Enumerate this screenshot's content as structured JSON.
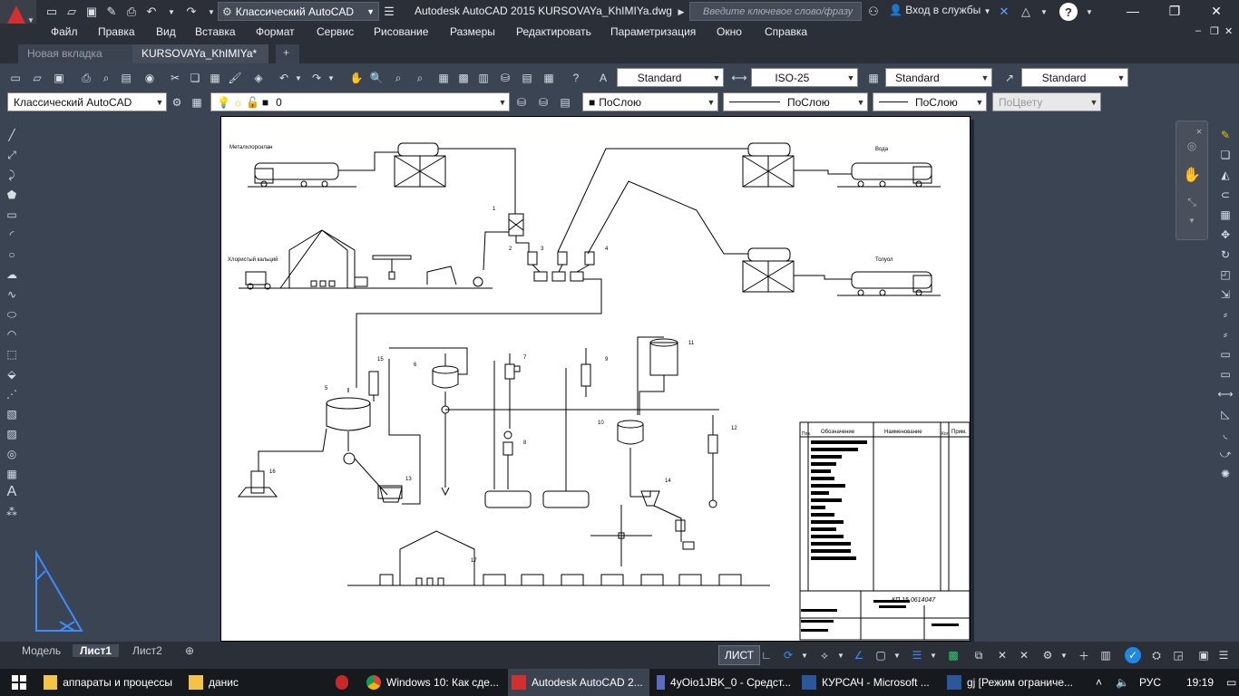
{
  "titlebar": {
    "workspace": "Классический AutoCAD",
    "app_title": "Autodesk AutoCAD 2015    KURSOVAYa_KhIMIYa.dwg",
    "search_placeholder": "Введите ключевое слово/фразу",
    "signin": "Вход в службы",
    "help": "?"
  },
  "menu": [
    "Файл",
    "Правка",
    "Вид",
    "Вставка",
    "Формат",
    "Сервис",
    "Рисование",
    "Размеры",
    "Редактировать",
    "Параметризация",
    "Окно",
    "Справка"
  ],
  "tabs": {
    "new_tab": "Новая вкладка",
    "active_tab": "KURSOVAYa_KhIMIYa*",
    "add": "+"
  },
  "toolbar1": {
    "text_style": "Standard",
    "dim_style": "ISO-25",
    "table_style": "Standard",
    "mleader_style": "Standard"
  },
  "toolbar2": {
    "workspace": "Классический AutoCAD",
    "layer": "0",
    "color": "ПоСлою",
    "linetype": "ПоСлою",
    "lineweight": "ПоСлою",
    "plotstyle": "ПоЦвету"
  },
  "layout_tabs": [
    "Модель",
    "Лист1",
    "Лист2"
  ],
  "status": {
    "sheet_label": "ЛИСТ"
  },
  "drawing": {
    "labels": {
      "metal": "Металхлорсилан",
      "water": "Вода",
      "calcium": "Хлористый кальций",
      "toluene": "Толуол",
      "title_code": "КП 15 0614047"
    },
    "numbers": [
      "1",
      "2",
      "3",
      "4",
      "5",
      "6",
      "7",
      "8",
      "9",
      "10",
      "11",
      "12",
      "13",
      "14",
      "15",
      "16",
      "17"
    ],
    "table_headers": [
      "Поз.",
      "Обозначение",
      "Наименование",
      "Кол.",
      "Прим."
    ]
  },
  "taskbar": {
    "items": [
      "аппараты и процессы",
      "данис",
      "Windows 10: Как сде...",
      "Autodesk AutoCAD 2...",
      "4yOio1JBK_0 - Средст...",
      "КУРСАЧ - Microsoft ...",
      "gj [Режим ограниче..."
    ],
    "lang": "РУС",
    "time": "19:19"
  },
  "colors": {
    "chrome": "#2b2f38",
    "workspace_bg": "#3b4453",
    "paper": "#ffffff",
    "brand_red": "#d32f2f",
    "accent_blue": "#1e88e5"
  }
}
